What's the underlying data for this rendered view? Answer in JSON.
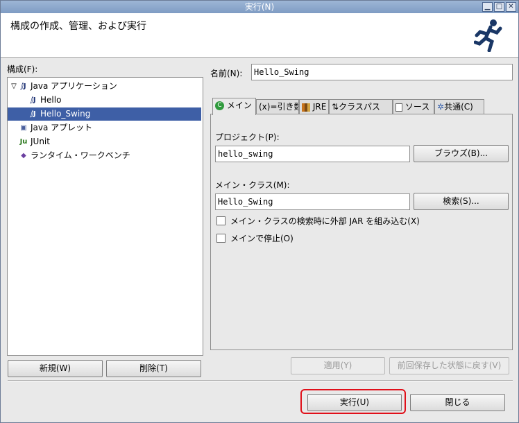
{
  "window": {
    "title": "実行(N)",
    "header": "構成の作成、管理、および実行"
  },
  "left": {
    "config_label": "構成(F):",
    "tree": [
      {
        "label": "Java アプリケーション",
        "level": 0,
        "expand": "▽",
        "icon": "java-app-icon"
      },
      {
        "label": "Hello",
        "level": 1,
        "icon": "java-class-icon"
      },
      {
        "label": "Hello_Swing",
        "level": 1,
        "icon": "java-class-icon",
        "selected": true
      },
      {
        "label": "Java アプレット",
        "level": 0,
        "icon": "java-applet-icon"
      },
      {
        "label": "JUnit",
        "level": 0,
        "icon": "junit-icon"
      },
      {
        "label": "ランタイム・ワークベンチ",
        "level": 0,
        "icon": "workbench-icon"
      }
    ],
    "new_button": "新規(W)",
    "delete_button": "削除(T)"
  },
  "right": {
    "name_label": "名前(N):",
    "name_value": "Hello_Swing",
    "tabs": [
      {
        "label": "メイン",
        "icon": "main-tab-icon"
      },
      {
        "label": "(x)=引き数",
        "icon": "args-tab-icon"
      },
      {
        "label": "JRE",
        "icon": "jre-tab-icon"
      },
      {
        "label": "クラスパス",
        "icon": "classpath-tab-icon"
      },
      {
        "label": "ソース",
        "icon": "source-tab-icon"
      },
      {
        "label": "共通(C)",
        "icon": "common-tab-icon"
      }
    ],
    "project_label": "プロジェクト(P):",
    "project_value": "hello_swing",
    "browse_button": "ブラウズ(B)...",
    "main_class_label": "メイン・クラス(M):",
    "main_class_value": "Hello_Swing",
    "search_button": "検索(S)...",
    "include_jar_label": "メイン・クラスの検索時に外部 JAR を組み込む(X)",
    "stop_in_main_label": "メインで停止(O)",
    "apply_button": "適用(Y)",
    "revert_button": "前回保存した状態に戻す(V)"
  },
  "footer": {
    "run_button": "実行(U)",
    "close_button": "閉じる"
  },
  "colors": {
    "selection": "#3e5fa6",
    "highlight_border": "#e0101a"
  }
}
